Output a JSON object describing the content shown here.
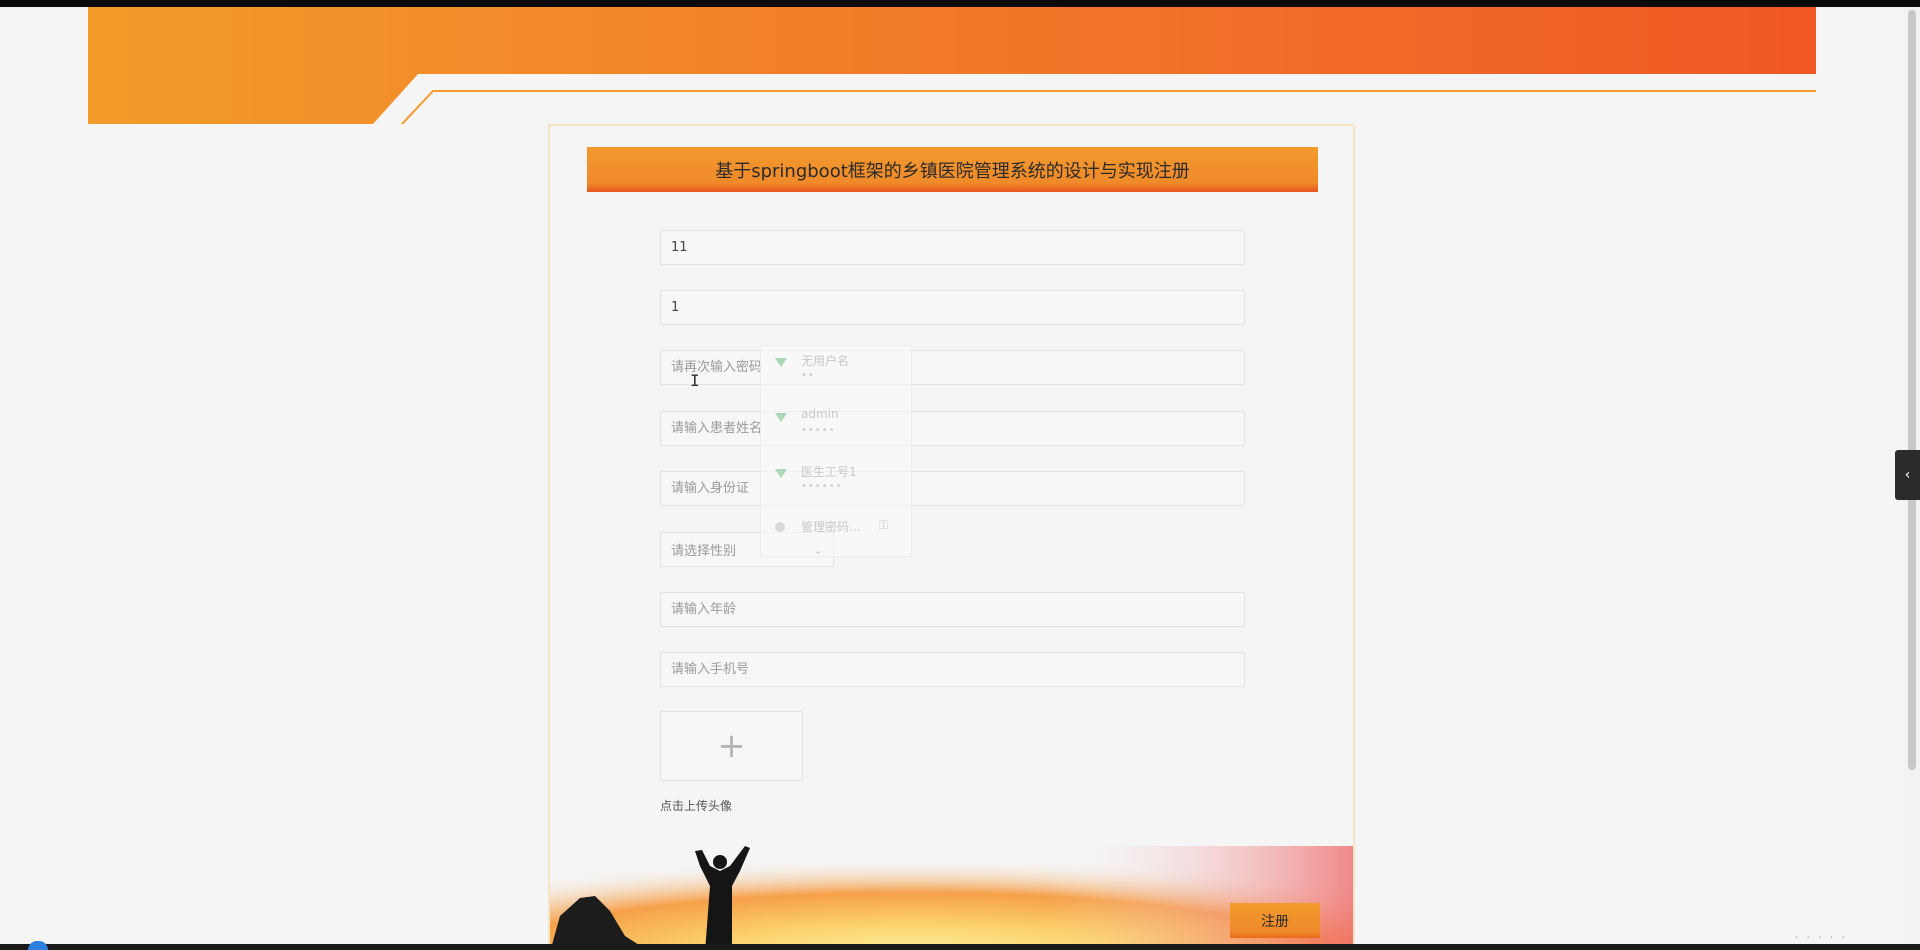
{
  "form": {
    "title": "基于springboot框架的乡镇医院管理系统的设计与实现注册",
    "fields": {
      "username_value": "11",
      "password_value": "1",
      "password_confirm_placeholder": "请再次输入密码",
      "patient_name_placeholder": "请输入患者姓名",
      "id_card_placeholder": "请输入身份证",
      "age_placeholder": "请输入年龄",
      "phone_placeholder": "请输入手机号"
    },
    "gender_select_placeholder": "请选择性别",
    "upload_plus": "+",
    "upload_label": "点击上传头像",
    "register_button": "注册"
  },
  "autofill": {
    "items": [
      {
        "name": "无用户名",
        "dots": "••"
      },
      {
        "name": "admin",
        "dots": "•••••"
      },
      {
        "name": "医生工号1",
        "dots": "••••••"
      }
    ],
    "manage_label": "管理密码..."
  },
  "icons": {
    "side_toggle": "chevron-left-icon",
    "select_chevron": "chevron-down-icon",
    "upload": "plus-icon",
    "autofill_entry": "key-triangle-icon",
    "autofill_manage": "globe-icon"
  },
  "colors": {
    "accent_orange": "#f39a2d",
    "accent_red": "#e6541f",
    "background": "#f5f5f5"
  }
}
